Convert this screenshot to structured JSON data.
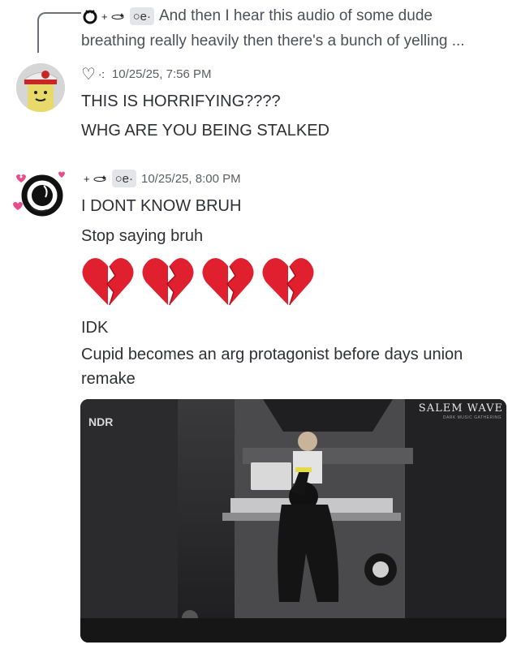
{
  "reply": {
    "text_line1": "And then I hear this audio of some dude",
    "text_line2": "breathing really heavily then there's a bunch of yelling ..."
  },
  "messages": [
    {
      "timestamp": "10/25/25, 7:56 PM",
      "lines": [
        "THIS IS HORRIFYING????",
        "WHG ARE YOU BEING STALKED"
      ]
    },
    {
      "timestamp": "10/25/25, 8:00 PM",
      "lines": [
        "I DONT KNOW BRUH",
        "Stop saying bruh",
        "IDK",
        "Cupid becomes an arg protagonist before days union",
        "remake"
      ],
      "emoji": [
        "broken-heart",
        "broken-heart",
        "broken-heart",
        "broken-heart"
      ],
      "video": {
        "broadcaster": "NDR",
        "watermark_title": "SALEM WAVE",
        "watermark_subtitle": "DARK MUSIC GATHERING"
      }
    }
  ],
  "tag_chip": "○e·",
  "heart_glyph": "♡",
  "colors": {
    "text": "#2e3035",
    "muted": "#4e5058",
    "timestamp": "#5c5e66",
    "broken_heart": "#e0202f"
  }
}
